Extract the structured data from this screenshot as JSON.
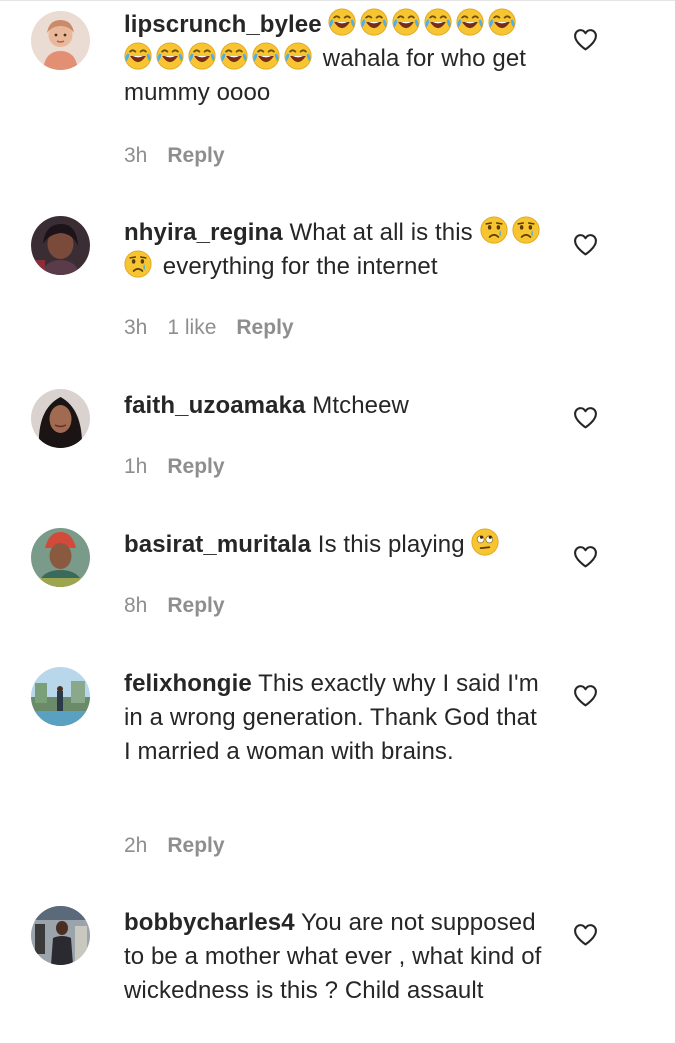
{
  "colors": {
    "text": "#262626",
    "meta": "#8e8e8e",
    "background": "#ffffff"
  },
  "comments": [
    {
      "username": "lipscrunch_bylee",
      "emoji_lead": [
        "face-with-tears-of-joy",
        "face-with-tears-of-joy",
        "face-with-tears-of-joy",
        "face-with-tears-of-joy",
        "face-with-tears-of-joy",
        "face-with-tears-of-joy",
        "face-with-tears-of-joy",
        "face-with-tears-of-joy",
        "face-with-tears-of-joy",
        "face-with-tears-of-joy",
        "face-with-tears-of-joy",
        "face-with-tears-of-joy"
      ],
      "text": "wahala for who get mummy oooo",
      "time": "3h",
      "likes": "",
      "reply_label": "Reply",
      "avatar_icon": "avatar-cartoon"
    },
    {
      "username": "nhyira_regina",
      "text": "What at all is this",
      "emoji_trail": [
        "crying-face",
        "crying-face",
        "crying-face"
      ],
      "text_after": "everything for the internet",
      "time": "3h",
      "likes": "1 like",
      "reply_label": "Reply",
      "avatar_icon": "avatar-photo"
    },
    {
      "username": "faith_uzoamaka",
      "text": "Mtcheew",
      "time": "1h",
      "likes": "",
      "reply_label": "Reply",
      "avatar_icon": "avatar-photo"
    },
    {
      "username": "basirat_muritala",
      "text": "Is this playing",
      "emoji_trail": [
        "face-with-rolling-eyes"
      ],
      "time": "8h",
      "likes": "",
      "reply_label": "Reply",
      "avatar_icon": "avatar-photo"
    },
    {
      "username": "felixhongie",
      "text": "This exactly why I said I'm in a wrong generation. Thank God that I married a woman with brains.",
      "time": "2h",
      "likes": "",
      "reply_label": "Reply",
      "avatar_icon": "avatar-photo"
    },
    {
      "username": "bobbycharles4",
      "text": "You are not supposed to be a mother what ever , what kind of wickedness is this ? Child assault",
      "avatar_icon": "avatar-photo"
    }
  ]
}
